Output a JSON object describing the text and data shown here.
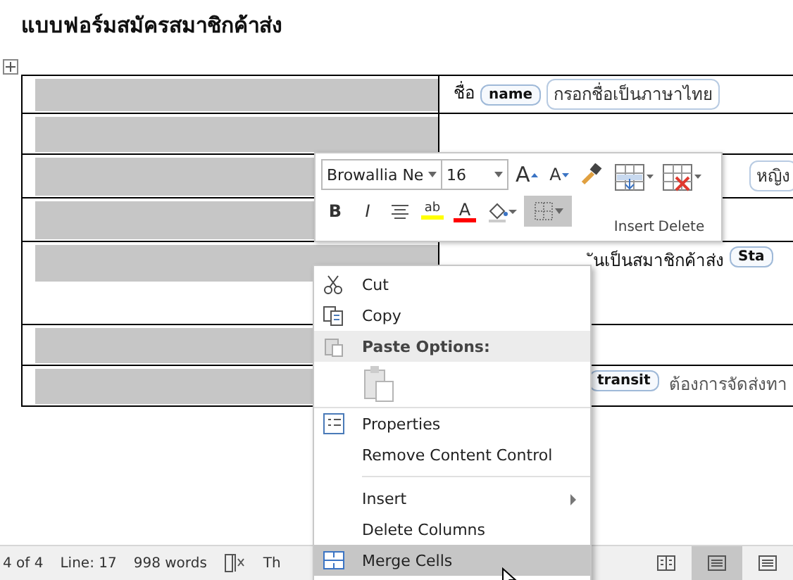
{
  "document": {
    "title": "แบบฟอร์มสมัครสมาชิกค้าส่ง",
    "rows": [
      {
        "kind": "full",
        "label": "ชื่อ",
        "tag": "name",
        "value": "กรอกชื่อเป็นภาษาไทย"
      },
      {
        "kind": "empty"
      },
      {
        "kind": "end",
        "value": "หญิง"
      },
      {
        "kind": "empty"
      },
      {
        "kind": "late",
        "value": "ันเป็นสมาชิกค้าส่ง",
        "tag_after": "Sta"
      },
      {
        "kind": "empty"
      },
      {
        "kind": "late",
        "tag": "transit",
        "value": "ต้องการจัดส่งทา"
      }
    ]
  },
  "mini_toolbar": {
    "font": "Browallia Ne",
    "size": "16",
    "top_buttons": [
      {
        "glyph": "A",
        "kind": "grow"
      },
      {
        "glyph": "A",
        "kind": "shrink"
      },
      {
        "kind": "painter"
      }
    ],
    "bottom_buttons": [
      {
        "glyph": "B",
        "kind": "bold",
        "selected": false
      },
      {
        "glyph": "I",
        "kind": "italic",
        "selected": false
      },
      {
        "kind": "center",
        "selected": false
      },
      {
        "glyph": "ab",
        "kind": "highlight",
        "color": "#ffff00",
        "selected": false
      },
      {
        "glyph": "A",
        "kind": "fontcolor",
        "color": "#ff0000",
        "selected": false
      },
      {
        "kind": "shading",
        "selected": false
      },
      {
        "kind": "borders",
        "selected": true
      }
    ],
    "actions": [
      {
        "label": "Insert"
      },
      {
        "label": "Delete"
      }
    ]
  },
  "context_menu": [
    {
      "kind": "item",
      "label": "Cut",
      "selected": false
    },
    {
      "kind": "item",
      "label": "Copy",
      "selected": false
    },
    {
      "kind": "header",
      "label": "Paste Options:"
    },
    {
      "kind": "paste"
    },
    {
      "kind": "item",
      "label": "Properties",
      "selected": false
    },
    {
      "kind": "item",
      "label": "Remove Content Control",
      "selected": false
    },
    {
      "kind": "separator"
    },
    {
      "kind": "submenu",
      "label": "Insert",
      "selected": false
    },
    {
      "kind": "item",
      "label": "Delete Columns",
      "selected": false
    },
    {
      "kind": "item",
      "label": "Merge Cells",
      "selected": true
    }
  ],
  "status_bar": {
    "items": [
      "4 of 4",
      "Line: 17",
      "998 words"
    ],
    "trailing": "Th",
    "views": [
      {
        "selected": false
      },
      {
        "selected": true
      },
      {
        "selected": false
      }
    ]
  }
}
